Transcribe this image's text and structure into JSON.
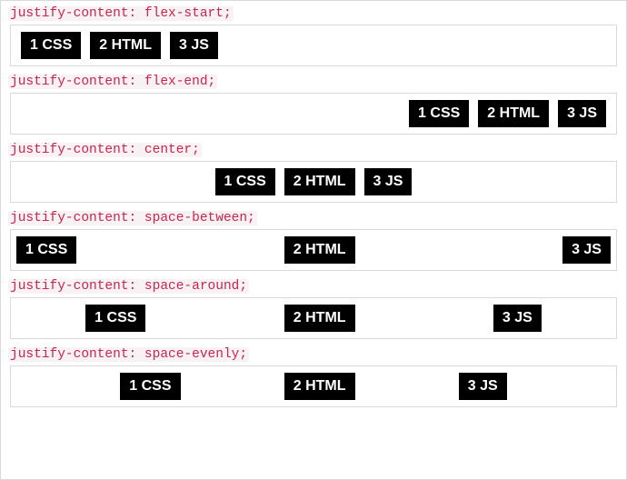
{
  "sections": [
    {
      "label": "justify-content: flex-start;",
      "class": "r-start"
    },
    {
      "label": "justify-content: flex-end;",
      "class": "r-end"
    },
    {
      "label": "justify-content: center;",
      "class": "r-center"
    },
    {
      "label": "justify-content: space-between;",
      "class": "r-between"
    },
    {
      "label": "justify-content: space-around;",
      "class": "r-around"
    },
    {
      "label": "justify-content: space-evenly;",
      "class": "r-evenly"
    }
  ],
  "items": [
    "1 CSS",
    "2 HTML",
    "3 JS"
  ]
}
